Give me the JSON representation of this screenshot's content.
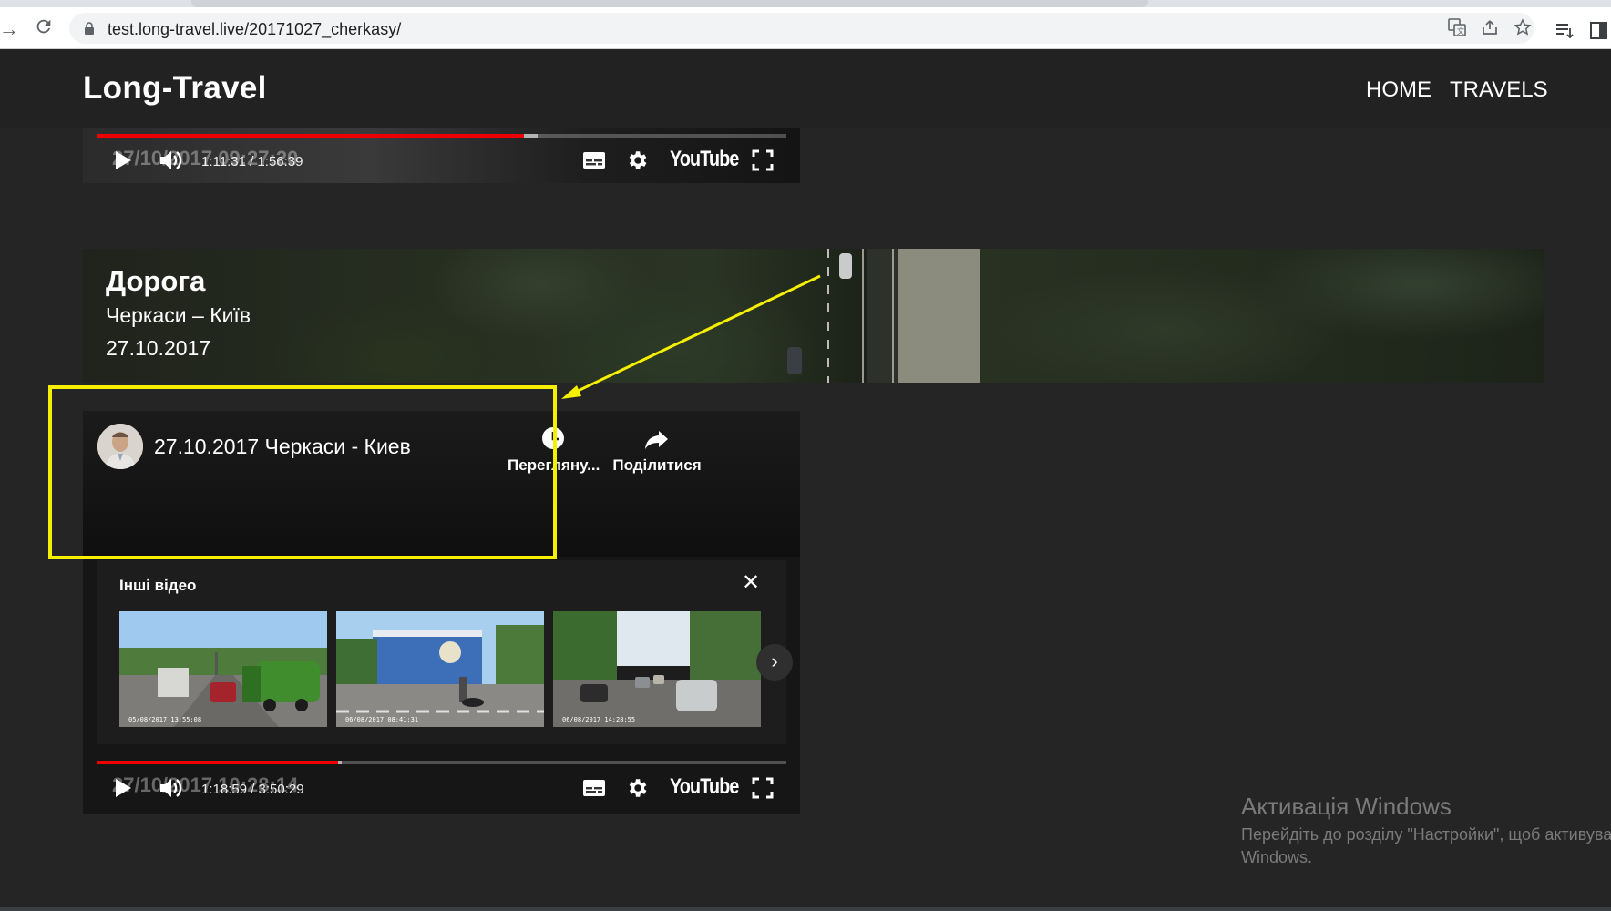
{
  "browser": {
    "url": "test.long-travel.live/20171027_cherkasy/",
    "icons": [
      "back-icon",
      "reload-icon",
      "lock-icon",
      "translate-icon",
      "share-icon",
      "star-icon",
      "reading-list-icon",
      "side-panel-icon"
    ]
  },
  "site": {
    "brand": "Long-Travel",
    "nav": [
      "HOME",
      "TRAVELS"
    ]
  },
  "player_top": {
    "time": "1:11:31 / 1:56:39",
    "overlay_stamp": "27/10/2017 09:27:20",
    "progress": 0.62,
    "buffered": 0.64,
    "logo": "YouTube"
  },
  "hero": {
    "title": "Дорога",
    "route": "Черкаси – Київ",
    "date": "27.10.2017"
  },
  "player": {
    "video_title": "27.10.2017 Черкаси - Киев",
    "actions": [
      "Перегляну...",
      "Поділитися"
    ],
    "more_videos_title": "Інші відео",
    "thumbs": [
      {
        "stamp": "05/08/2017  13:55:08"
      },
      {
        "stamp": "06/08/2017  08:41:31"
      },
      {
        "stamp": "06/08/2017  14:28:55"
      }
    ],
    "time": "1:18:59 / 3:50:29",
    "overlay_stamp": "27/10/2017 10:28:14",
    "progress": 0.35,
    "buffered": 0.355,
    "logo": "YouTube"
  },
  "windows_watermark": {
    "title": "Активація Windows",
    "line1": "Перейдіть до розділу \"Настройки\", щоб активувати",
    "line2": "Windows."
  },
  "colors": {
    "annotation": "#f7ef00",
    "progress": "#ee0000",
    "page_bg": "#252525"
  }
}
